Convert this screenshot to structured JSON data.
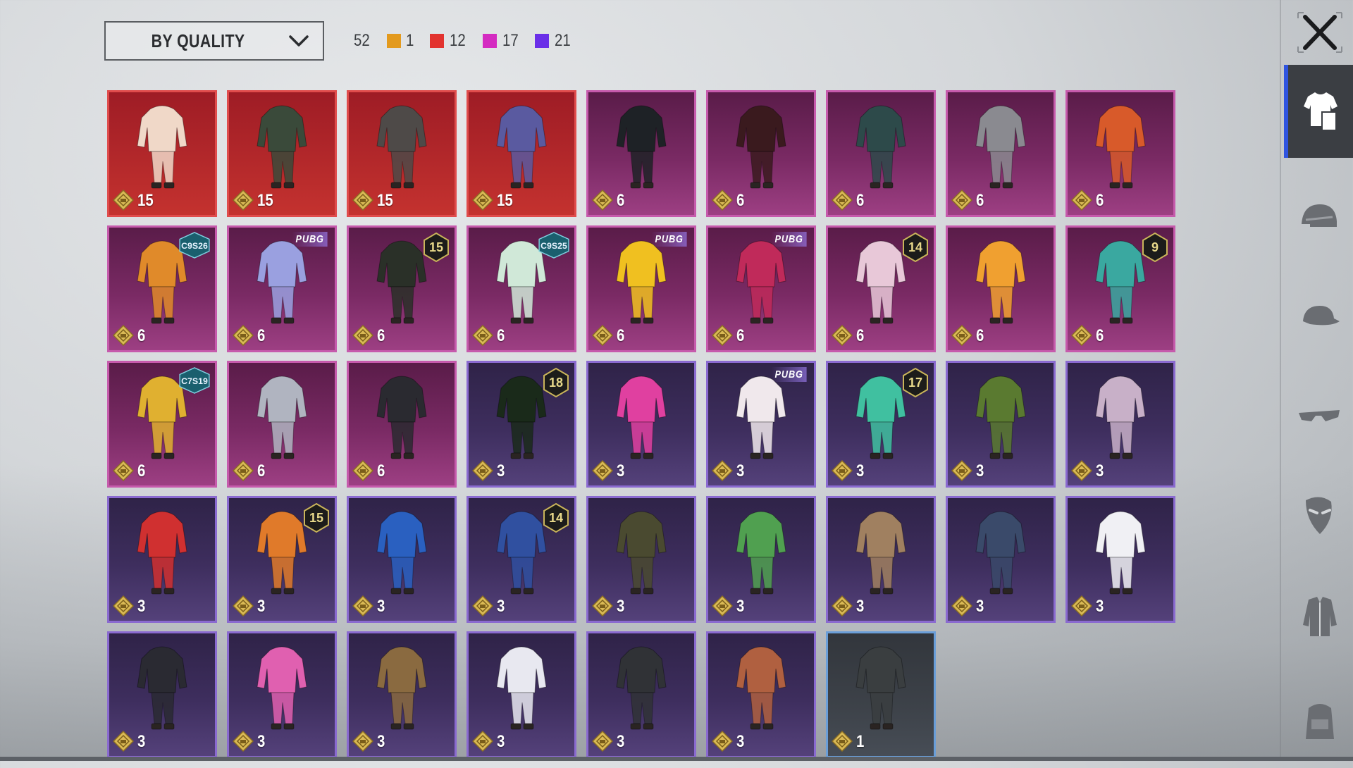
{
  "header": {
    "sort_label": "BY QUALITY",
    "total_count": "52",
    "quality_counts": [
      {
        "color": "#e39a1e",
        "count": "1"
      },
      {
        "color": "#e2332f",
        "count": "12"
      },
      {
        "color": "#d42bc1",
        "count": "17"
      },
      {
        "color": "#6a2fe8",
        "count": "21"
      }
    ]
  },
  "items": [
    {
      "quality": "orange-top",
      "value": "15",
      "color": "#f0d8c8",
      "badge": null
    },
    {
      "quality": "orange-top",
      "value": "15",
      "color": "#3a4a3a",
      "badge": null
    },
    {
      "quality": "orange-top",
      "value": "15",
      "color": "#4e4a48",
      "badge": null
    },
    {
      "quality": "orange-top",
      "value": "15",
      "color": "#5a5aa0",
      "badge": null
    },
    {
      "quality": "pink",
      "value": "6",
      "color": "#1e2226",
      "badge": null
    },
    {
      "quality": "pink",
      "value": "6",
      "color": "#3a1a1e",
      "badge": null
    },
    {
      "quality": "pink",
      "value": "6",
      "color": "#2d4a4a",
      "badge": null
    },
    {
      "quality": "pink",
      "value": "6",
      "color": "#8a8a90",
      "badge": null
    },
    {
      "quality": "pink",
      "value": "6",
      "color": "#d85a2a",
      "badge": null
    },
    {
      "quality": "pink",
      "value": "6",
      "color": "#e08a2a",
      "badge": {
        "type": "tag",
        "text": "C9S26"
      }
    },
    {
      "quality": "pink",
      "value": "6",
      "color": "#9aa0e0",
      "badge": {
        "type": "brand",
        "text": "PUBG"
      }
    },
    {
      "quality": "pink",
      "value": "6",
      "color": "#2a3028",
      "badge": {
        "type": "hex",
        "text": "15"
      }
    },
    {
      "quality": "pink",
      "value": "6",
      "color": "#d0e8d8",
      "badge": {
        "type": "tag",
        "text": "C9S25"
      }
    },
    {
      "quality": "pink",
      "value": "6",
      "color": "#f0c020",
      "badge": {
        "type": "brand",
        "text": "PUBG"
      }
    },
    {
      "quality": "pink",
      "value": "6",
      "color": "#c02a5a",
      "badge": {
        "type": "brand",
        "text": "PUBG"
      }
    },
    {
      "quality": "pink",
      "value": "6",
      "color": "#e8c8d8",
      "badge": {
        "type": "hex",
        "text": "14"
      }
    },
    {
      "quality": "pink",
      "value": "6",
      "color": "#f0a030",
      "badge": null
    },
    {
      "quality": "pink",
      "value": "6",
      "color": "#3aa8a0",
      "badge": {
        "type": "hex",
        "text": "9"
      }
    },
    {
      "quality": "pink",
      "value": "6",
      "color": "#e0b030",
      "badge": {
        "type": "tag",
        "text": "C7S19"
      }
    },
    {
      "quality": "pink",
      "value": "6",
      "color": "#b0b4c0",
      "badge": null
    },
    {
      "quality": "pink",
      "value": "6",
      "color": "#2a2a30",
      "badge": null
    },
    {
      "quality": "purple",
      "value": "3",
      "color": "#1a2a1a",
      "badge": {
        "type": "hex",
        "text": "18"
      }
    },
    {
      "quality": "purple",
      "value": "3",
      "color": "#e040a0",
      "badge": null
    },
    {
      "quality": "purple",
      "value": "3",
      "color": "#f0e8ec",
      "badge": {
        "type": "brand",
        "text": "PUBG"
      }
    },
    {
      "quality": "purple",
      "value": "3",
      "color": "#40c0a0",
      "badge": {
        "type": "hex",
        "text": "17"
      }
    },
    {
      "quality": "purple",
      "value": "3",
      "color": "#5a7a30",
      "badge": null
    },
    {
      "quality": "purple",
      "value": "3",
      "color": "#c8b0c8",
      "badge": null
    },
    {
      "quality": "purple",
      "value": "3",
      "color": "#d03030",
      "badge": null
    },
    {
      "quality": "purple",
      "value": "3",
      "color": "#e07a2a",
      "badge": {
        "type": "hex",
        "text": "15"
      }
    },
    {
      "quality": "purple",
      "value": "3",
      "color": "#2a60c0",
      "badge": null
    },
    {
      "quality": "purple",
      "value": "3",
      "color": "#3050a0",
      "badge": {
        "type": "hex",
        "text": "14"
      }
    },
    {
      "quality": "purple",
      "value": "3",
      "color": "#4a4a30",
      "badge": null
    },
    {
      "quality": "purple",
      "value": "3",
      "color": "#50a050",
      "badge": null
    },
    {
      "quality": "purple",
      "value": "3",
      "color": "#a08060",
      "badge": null
    },
    {
      "quality": "purple",
      "value": "3",
      "color": "#3a4a6a",
      "badge": null
    },
    {
      "quality": "purple",
      "value": "3",
      "color": "#f0f0f4",
      "badge": null
    },
    {
      "quality": "purple",
      "value": "3",
      "color": "#2a2a32",
      "badge": null
    },
    {
      "quality": "purple",
      "value": "3",
      "color": "#e060b0",
      "badge": null
    },
    {
      "quality": "purple",
      "value": "3",
      "color": "#8a6a40",
      "badge": null
    },
    {
      "quality": "purple",
      "value": "3",
      "color": "#e8e8f0",
      "badge": null
    },
    {
      "quality": "purple",
      "value": "3",
      "color": "#303236",
      "badge": null
    },
    {
      "quality": "purple",
      "value": "3",
      "color": "#b06040",
      "badge": null
    },
    {
      "quality": "grey",
      "value": "1",
      "color": "#3a3e40",
      "badge": null
    }
  ],
  "sidebar": [
    {
      "name": "outfit-category-icon",
      "active": true
    },
    {
      "name": "helmet-icon",
      "active": false
    },
    {
      "name": "cap-icon",
      "active": false
    },
    {
      "name": "glasses-icon",
      "active": false
    },
    {
      "name": "mask-icon",
      "active": false
    },
    {
      "name": "jacket-icon",
      "active": false
    },
    {
      "name": "backpack-icon",
      "active": false
    }
  ]
}
